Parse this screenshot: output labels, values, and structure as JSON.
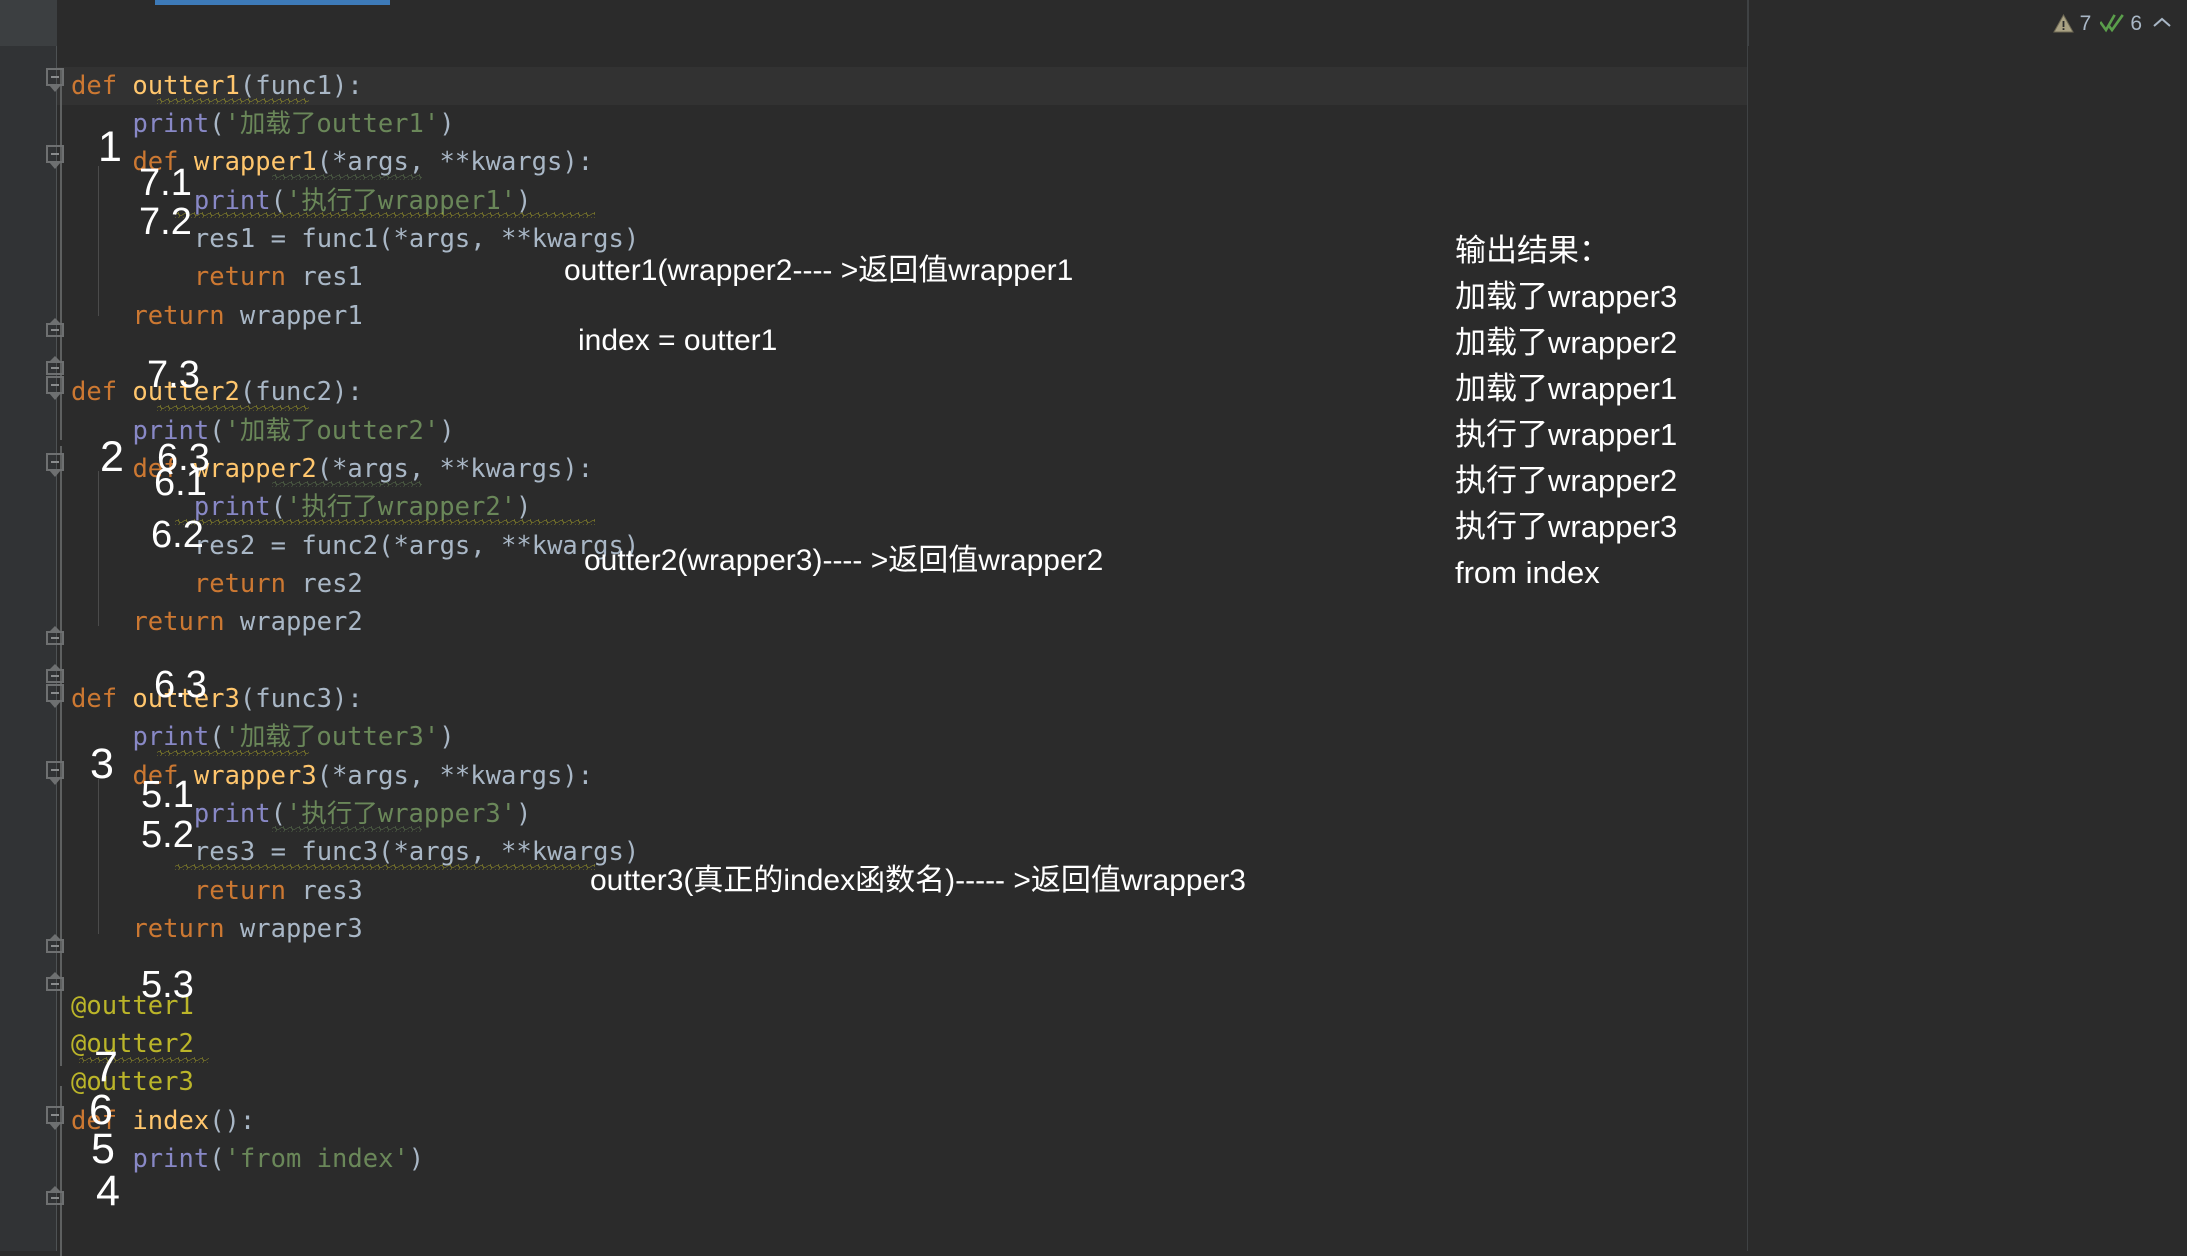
{
  "app": {
    "theme_bg": "#2b2b2b",
    "gutter_bg": "#313335",
    "accent_tab": "#3d7ab8"
  },
  "status_bar": {
    "warning_icon": "warning-triangle-icon",
    "warning_count": "7",
    "check_icon": "double-check-icon",
    "check_count": "6",
    "collapse_icon": "chevron-up-icon"
  },
  "code": {
    "language": "python",
    "lines": [
      {
        "id": "l1",
        "text": "def outter1(func1):"
      },
      {
        "id": "l2",
        "text": "    print('加载了outter1')"
      },
      {
        "id": "l3",
        "text": "    def wrapper1(*args, **kwargs):"
      },
      {
        "id": "l4",
        "text": "        print('执行了wrapper1')"
      },
      {
        "id": "l5",
        "text": "        res1 = func1(*args, **kwargs)"
      },
      {
        "id": "l6",
        "text": "        return res1"
      },
      {
        "id": "l7",
        "text": "    return wrapper1"
      },
      {
        "id": "l8",
        "text": ""
      },
      {
        "id": "l9",
        "text": "def outter2(func2):"
      },
      {
        "id": "l10",
        "text": "    print('加载了outter2')"
      },
      {
        "id": "l11",
        "text": "    def wrapper2(*args, **kwargs):"
      },
      {
        "id": "l12",
        "text": "        print('执行了wrapper2')"
      },
      {
        "id": "l13",
        "text": "        res2 = func2(*args, **kwargs)"
      },
      {
        "id": "l14",
        "text": "        return res2"
      },
      {
        "id": "l15",
        "text": "    return wrapper2"
      },
      {
        "id": "l16",
        "text": ""
      },
      {
        "id": "l17",
        "text": "def outter3(func3):"
      },
      {
        "id": "l18",
        "text": "    print('加载了outter3')"
      },
      {
        "id": "l19",
        "text": "    def wrapper3(*args, **kwargs):"
      },
      {
        "id": "l20",
        "text": "        print('执行了wrapper3')"
      },
      {
        "id": "l21",
        "text": "        res3 = func3(*args, **kwargs)"
      },
      {
        "id": "l22",
        "text": "        return res3"
      },
      {
        "id": "l23",
        "text": "    return wrapper3"
      },
      {
        "id": "l24",
        "text": ""
      },
      {
        "id": "l25",
        "text": "@outter1"
      },
      {
        "id": "l26",
        "text": "@outter2"
      },
      {
        "id": "l27",
        "text": "@outter3"
      },
      {
        "id": "l28",
        "text": "def index():"
      },
      {
        "id": "l29",
        "text": "    print('from index')"
      }
    ]
  },
  "annotations": {
    "order_marks": [
      {
        "id": "a1",
        "label": "1"
      },
      {
        "id": "a71",
        "label": "7.1"
      },
      {
        "id": "a72",
        "label": "7.2"
      },
      {
        "id": "a73",
        "label": "7.3"
      },
      {
        "id": "a2",
        "label": "2"
      },
      {
        "id": "a63",
        "label": "6.3"
      },
      {
        "id": "a61",
        "label": "6.1"
      },
      {
        "id": "a62",
        "label": "6.2"
      },
      {
        "id": "a63b",
        "label": "6.3"
      },
      {
        "id": "a3",
        "label": "3"
      },
      {
        "id": "a51",
        "label": "5.1"
      },
      {
        "id": "a52",
        "label": "5.2"
      },
      {
        "id": "a53",
        "label": "5.3"
      },
      {
        "id": "a7",
        "label": "7"
      },
      {
        "id": "a6",
        "label": "6"
      },
      {
        "id": "a5",
        "label": "5"
      },
      {
        "id": "a4",
        "label": "4"
      }
    ],
    "notes": [
      {
        "id": "n1",
        "text": "outter1(wrapper2---- >返回值wrapper1"
      },
      {
        "id": "n2",
        "text": "index = outter1"
      },
      {
        "id": "n3",
        "text": "outter2(wrapper3)---- >返回值wrapper2"
      },
      {
        "id": "n4",
        "text": "outter3(真正的index函数名)----- >返回值wrapper3"
      }
    ]
  },
  "output_panel": {
    "title": "输出结果：",
    "lines": [
      "加载了wrapper3",
      "加载了wrapper2",
      "加载了wrapper1",
      "执行了wrapper1",
      "执行了wrapper2",
      "执行了wrapper3",
      "from index"
    ]
  }
}
